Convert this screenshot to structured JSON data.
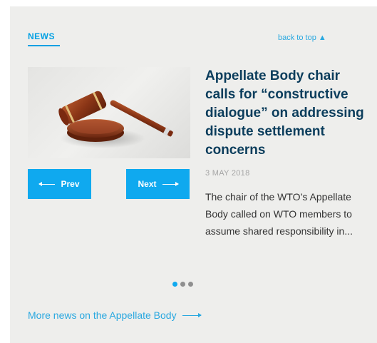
{
  "section": {
    "label": "NEWS",
    "back_to_top": "back to top ▲"
  },
  "article": {
    "headline": "Appellate Body chair calls for “constructive dialogue” on addressing dispute settlement concerns",
    "date": "3 MAY 2018",
    "excerpt": "The chair of the WTO’s Appellate Body called on WTO members to assume shared responsibility in...",
    "image_subject": "gavel"
  },
  "navigation": {
    "prev_label": "Prev",
    "next_label": "Next"
  },
  "pagination": {
    "total": 3,
    "active_index": 0
  },
  "footer": {
    "more_news_label": "More news on the Appellate Body"
  },
  "colors": {
    "accent": "#0fa9ef",
    "headline": "#0b3d5c",
    "background": "#eeeeec"
  }
}
